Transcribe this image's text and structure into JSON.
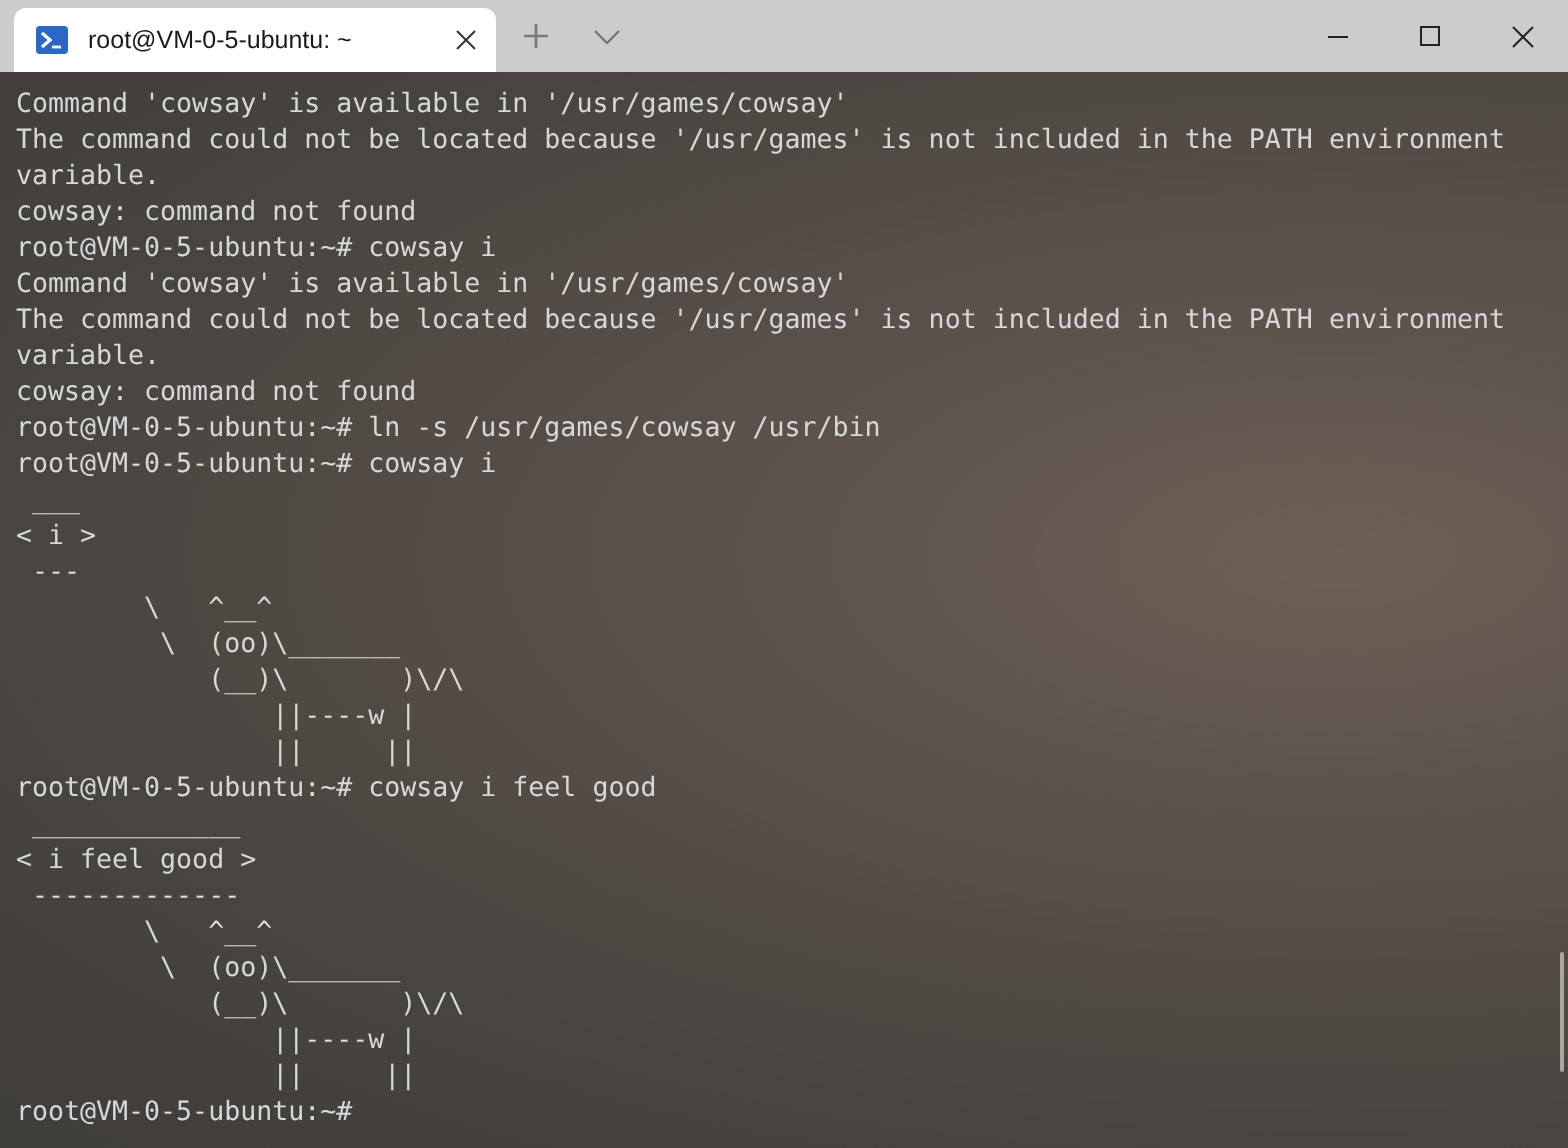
{
  "window": {
    "tabs": [
      {
        "title": "root@VM-0-5-ubuntu: ~",
        "selected": true
      }
    ]
  },
  "terminal": {
    "lines": [
      "Command 'cowsay' is available in '/usr/games/cowsay'",
      "The command could not be located because '/usr/games' is not included in the PATH environment",
      "variable.",
      "cowsay: command not found",
      "root@VM-0-5-ubuntu:~# cowsay i",
      "Command 'cowsay' is available in '/usr/games/cowsay'",
      "The command could not be located because '/usr/games' is not included in the PATH environment",
      "variable.",
      "cowsay: command not found",
      "root@VM-0-5-ubuntu:~# ln -s /usr/games/cowsay /usr/bin",
      "root@VM-0-5-ubuntu:~# cowsay i",
      " ___",
      "< i >",
      " ---",
      "        \\   ^__^",
      "         \\  (oo)\\_______",
      "            (__)\\       )\\/\\",
      "                ||----w |",
      "                ||     ||",
      "root@VM-0-5-ubuntu:~# cowsay i feel good",
      " _____________",
      "< i feel good >",
      " -------------",
      "        \\   ^__^",
      "         \\  (oo)\\_______",
      "            (__)\\       )\\/\\",
      "                ||----w |",
      "                ||     ||",
      "root@VM-0-5-ubuntu:~#"
    ]
  }
}
